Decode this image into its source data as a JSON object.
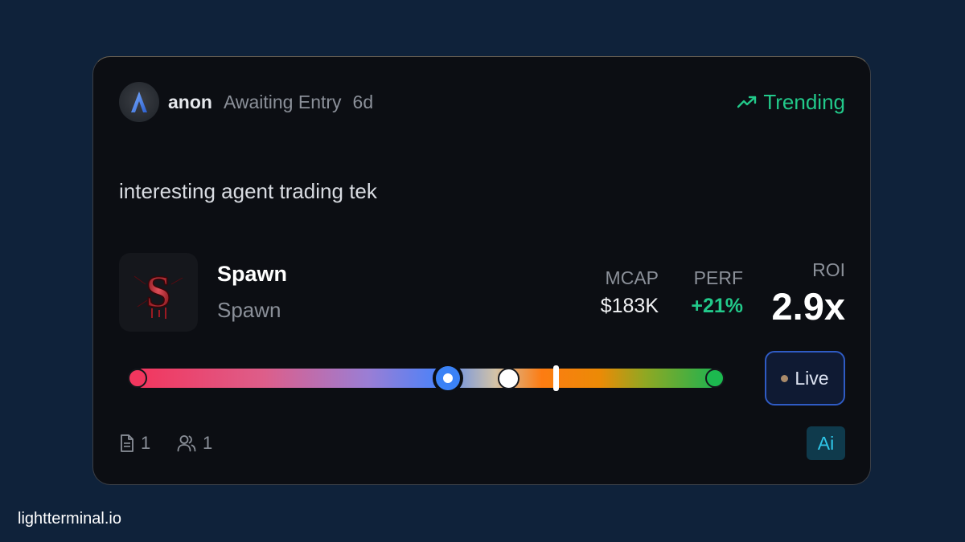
{
  "post": {
    "author": "anon",
    "status": "Awaiting Entry",
    "age": "6d",
    "avatar_icon": "chevron-up-icon",
    "trending_label": "Trending",
    "trending_icon": "trending-up-icon",
    "note": "interesting agent trading tek"
  },
  "token": {
    "name": "Spawn",
    "subtitle": "Spawn",
    "image_icon": "bloody-s-logo",
    "image_letter": "S"
  },
  "stats": {
    "mcap_label": "MCAP",
    "mcap_value": "$183K",
    "perf_label": "PERF",
    "perf_value": "+21%",
    "roi_label": "ROI",
    "roi_value": "2.9x"
  },
  "live_button": {
    "label": "Live",
    "dot_icon": "status-dot-icon"
  },
  "footer": {
    "docs_count": "1",
    "docs_icon": "document-icon",
    "users_count": "1",
    "users_icon": "users-icon",
    "ai_badge": "Ai"
  },
  "site": "lightterminal.io",
  "colors": {
    "background": "#0f223a",
    "card": "#0c0e13",
    "accent_green": "#22c98a",
    "entry_blue": "#3b82f6",
    "live_border": "#2f5bc4",
    "ai_text": "#2fc6e8"
  }
}
